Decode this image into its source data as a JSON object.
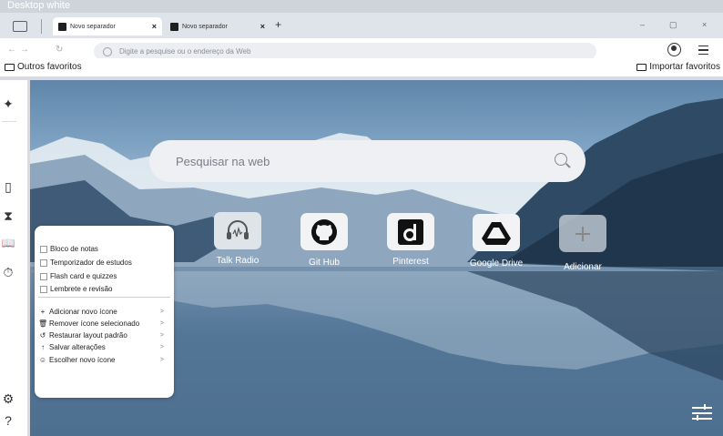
{
  "window": {
    "title": "Desktop white"
  },
  "tabs": [
    {
      "label": "Novo separador",
      "active": true
    },
    {
      "label": "Novo separador",
      "active": false
    }
  ],
  "tabbar": {
    "new_tab": "+",
    "close": "×",
    "minimize": "–",
    "maximize": "▢",
    "window_close": "×"
  },
  "nav": {
    "back": "←",
    "forward": "→",
    "reload": "↻",
    "address_placeholder": "Digite a pesquise  ou o endereço da Web"
  },
  "bookmarks": {
    "left": "Outros favoritos",
    "right": "Importar favoritos"
  },
  "sidebar": {
    "icons": [
      "sparkle-icon",
      "notebook-icon",
      "hourglass-icon",
      "book-icon",
      "stopwatch-icon",
      "gear-icon",
      "help-icon"
    ],
    "glyphs": {
      "sparkle": "✦",
      "notebook": "▯",
      "hourglass": "⧗",
      "book": "📖",
      "stopwatch": "⏱",
      "gear": "⚙",
      "help": "?"
    }
  },
  "search": {
    "placeholder": "Pesquisar na web"
  },
  "shortcuts": [
    {
      "label": "Talk Radio",
      "icon": "headphones-icon"
    },
    {
      "label": "Git Hub",
      "icon": "github-icon"
    },
    {
      "label": "Pinterest",
      "icon": "pinterest-icon"
    },
    {
      "label": "Google Drive",
      "icon": "drive-icon"
    },
    {
      "label": "Adicionar",
      "icon": "plus-icon"
    }
  ],
  "popup": {
    "checks": [
      "Bloco de notas",
      "Temporizador de estudos",
      "Flash card e quizzes",
      "Lembrete e revisão"
    ],
    "actions": [
      {
        "label": "Adicionar novo ícone",
        "glyph": "+"
      },
      {
        "label": "Remover ícone selecionado",
        "glyph": "🗑"
      },
      {
        "label": "Restaurar layout padrão",
        "glyph": "↺"
      },
      {
        "label": "Salvar alterações",
        "glyph": "↑"
      },
      {
        "label": "Escolher novo ícone",
        "glyph": "☺"
      }
    ],
    "chevron": ">"
  },
  "colors": {
    "tabbar_bg": "#dfe3ea",
    "popup_bg": "#ffffff",
    "search_bg": "#eef0f3",
    "tile_bg": "#f1f3f5"
  }
}
